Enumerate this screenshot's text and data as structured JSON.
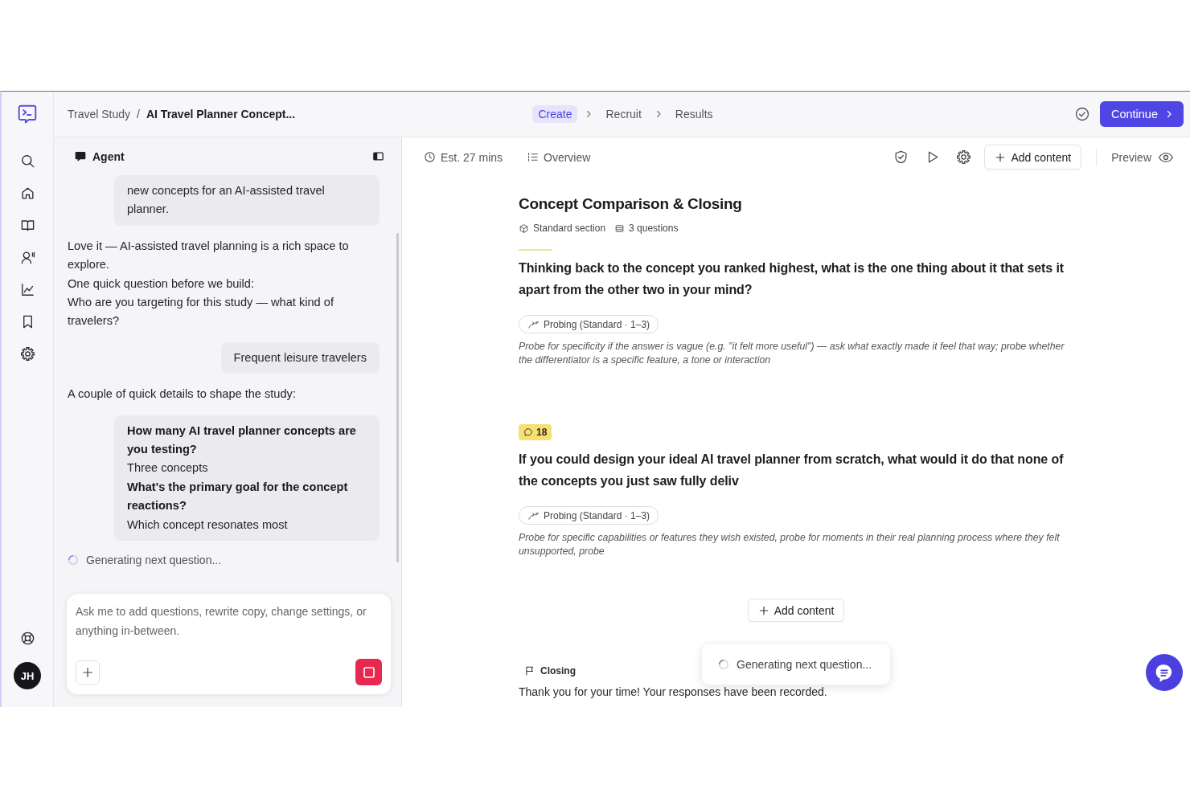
{
  "sidebar": {
    "avatar": "JH"
  },
  "top_bar": {
    "breadcrumb": [
      "Travel Study",
      "AI Travel Planner Concept..."
    ],
    "breadcrumb_separator": "/",
    "steps": [
      {
        "label": "Create",
        "selected": true
      },
      {
        "label": "Recruit",
        "selected": false
      },
      {
        "label": "Results",
        "selected": false
      }
    ],
    "continue_button": "Continue"
  },
  "agent_panel": {
    "title": "Agent",
    "messages": [
      {
        "kind": "user",
        "lines": [
          {
            "kind": "plain",
            "text": "new concepts for an AI-assisted travel planner."
          }
        ]
      },
      {
        "kind": "agent",
        "lines": [
          {
            "kind": "plain",
            "text": "Love it — AI-assisted travel planning is a rich space to explore."
          },
          {
            "kind": "plain",
            "text": "One quick question before we build:"
          },
          {
            "kind": "plain",
            "text": "Who are you targeting for this study — what kind of travelers?"
          }
        ]
      },
      {
        "kind": "user",
        "lines": [
          {
            "kind": "plain",
            "text": "Frequent leisure travelers"
          }
        ]
      },
      {
        "kind": "agent",
        "lines": [
          {
            "kind": "plain",
            "text": "A couple of quick details to shape the study:"
          }
        ]
      },
      {
        "kind": "user",
        "lines": [
          {
            "kind": "question",
            "text": "How many AI travel planner concepts are you testing?"
          },
          {
            "kind": "answer",
            "text": "Three concepts"
          },
          {
            "kind": "question",
            "text": "What's the primary goal for the concept reactions?"
          },
          {
            "kind": "answer",
            "text": "Which concept resonates most"
          }
        ]
      }
    ],
    "status": "Generating next question...",
    "composer": {
      "placeholder": "Ask me to add questions, rewrite copy, change settings, or anything in-between."
    }
  },
  "editor": {
    "toolbar": {
      "duration": "Est. 27 mins",
      "overview": "Overview",
      "add_content": "Add content",
      "preview": "Preview"
    },
    "section": {
      "title": "Concept Comparison & Closing",
      "type": "Standard section",
      "question_count": "3 questions",
      "questions": [
        {
          "highlighted": true,
          "text": "Thinking back to the concept you ranked highest, what is the one thing about it that sets it apart from the other two in your mind?",
          "probing": "Probing (Standard · 1–3)",
          "note": "Probe for specificity if the answer is vague (e.g. \"it felt more useful\") — ask what exactly made it feel that way; probe whether the differentiator is a specific feature, a tone or interaction"
        },
        {
          "highlighted": false,
          "comments": "18",
          "text": "If you could design your ideal AI travel planner from scratch, what would it do that none of the concepts you just saw fully deliv",
          "probing": "Probing (Standard · 1–3)",
          "note": "Probe for specific capabilities or features they wish existed, probe for moments in their real planning process where they felt unsupported, probe"
        }
      ]
    },
    "add_content": "Add content",
    "closing": {
      "label": "Closing",
      "text": "Thank you for your time! Your responses have been recorded."
    },
    "toast": "Generating next question..."
  }
}
